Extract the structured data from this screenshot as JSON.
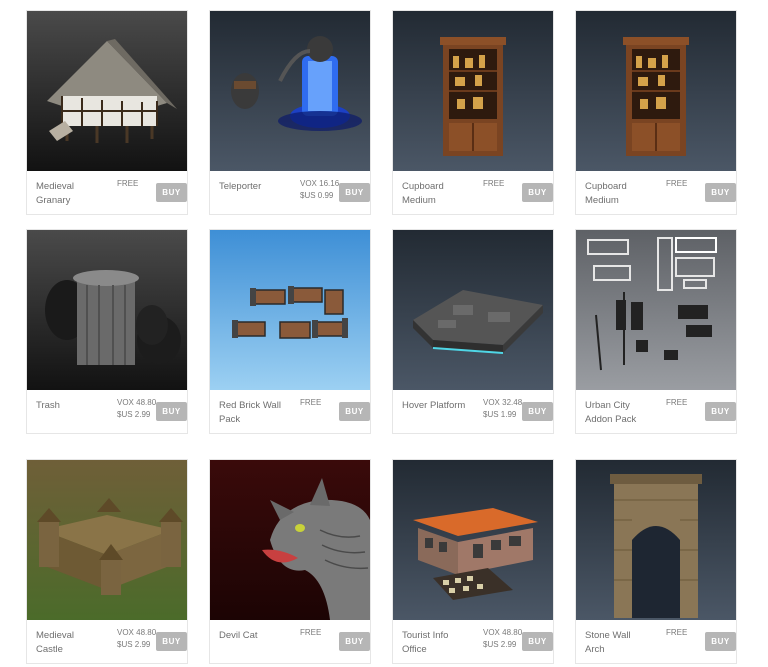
{
  "buy_label": "BUY",
  "items": [
    {
      "name": "Medieval Granary",
      "price_1": "FREE",
      "price_2": "",
      "thumb": "medieval-granary-image",
      "bg": "dark"
    },
    {
      "name": "Teleporter",
      "price_1": "VOX 16.16",
      "price_2": "$US 0.99",
      "thumb": "teleporter-image",
      "bg": "navy"
    },
    {
      "name": "Cupboard Medium",
      "price_1": "FREE",
      "price_2": "",
      "thumb": "cupboard-image",
      "bg": "navy"
    },
    {
      "name": "Cupboard Medium",
      "price_1": "FREE",
      "price_2": "",
      "thumb": "cupboard-image",
      "bg": "navy"
    },
    {
      "name": "Trash",
      "price_1": "VOX 48.80",
      "price_2": "$US 2.99",
      "thumb": "trash-image",
      "bg": "dark"
    },
    {
      "name": "Red Brick Wall Pack",
      "price_1": "FREE",
      "price_2": "",
      "thumb": "brick-wall-image",
      "bg": "sky"
    },
    {
      "name": "Hover Platform",
      "price_1": "VOX 32.48",
      "price_2": "$US 1.99",
      "thumb": "hover-platform-image",
      "bg": "navy"
    },
    {
      "name": "Urban City Addon Pack",
      "price_1": "FREE",
      "price_2": "",
      "thumb": "urban-city-image",
      "bg": "grey"
    },
    {
      "name": "Medieval Castle",
      "price_1": "VOX 48.80",
      "price_2": "$US 2.99",
      "thumb": "castle-image",
      "bg": "olive"
    },
    {
      "name": "Devil Cat",
      "price_1": "FREE",
      "price_2": "",
      "thumb": "devil-cat-image",
      "bg": "maroon"
    },
    {
      "name": "Tourist Info Office",
      "price_1": "VOX 48.80",
      "price_2": "$US 2.99",
      "thumb": "tourist-office-image",
      "bg": "navy"
    },
    {
      "name": "Stone Wall Arch",
      "price_1": "FREE",
      "price_2": "",
      "thumb": "stone-arch-image",
      "bg": "navy"
    }
  ],
  "colors": {
    "buy_button": "#b6b6b6",
    "text": "#6f6f6f",
    "border": "#e6e6e6"
  }
}
